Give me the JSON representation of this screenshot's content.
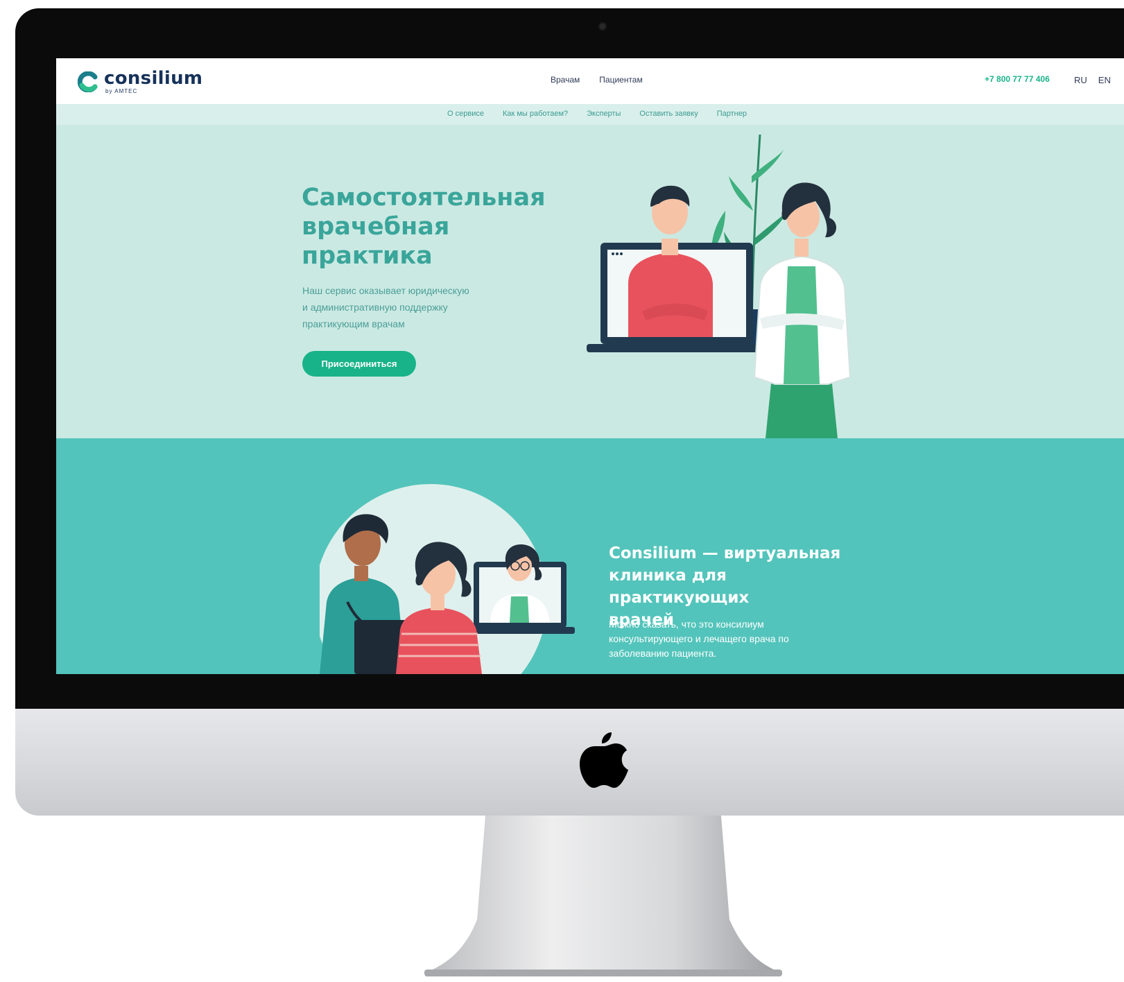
{
  "brand": {
    "name": "consilium",
    "sub": "by AMTEC",
    "accent": "#19b38a",
    "teal": "#53c4bb",
    "dark": "#16325a"
  },
  "nav": {
    "main": [
      "Врачам",
      "Пациентам"
    ],
    "phone": "+7 800 77 77 406",
    "languages": [
      "RU",
      "EN"
    ],
    "sub": [
      "О сервисе",
      "Как мы работаем?",
      "Эксперты",
      "Оставить заявку",
      "Партнер"
    ]
  },
  "hero": {
    "title_lines": [
      "Самостоятельная",
      "врачебная",
      "практика"
    ],
    "desc_lines": [
      "Наш сервис оказывает юридическую",
      "и административную поддержку",
      "практикующим врачам"
    ],
    "cta": "Присоединиться"
  },
  "section2": {
    "title_lines": [
      "Consilium — виртуальная",
      "клиника для практикующих",
      "врачей"
    ],
    "desc_lines": [
      "Можно сказать, что это консилиум",
      "консультирующего и лечащего врача по",
      "заболеванию пациента."
    ]
  },
  "icons": {
    "logo": "consilium-c-logo-icon",
    "apple": "apple-logo-icon"
  }
}
